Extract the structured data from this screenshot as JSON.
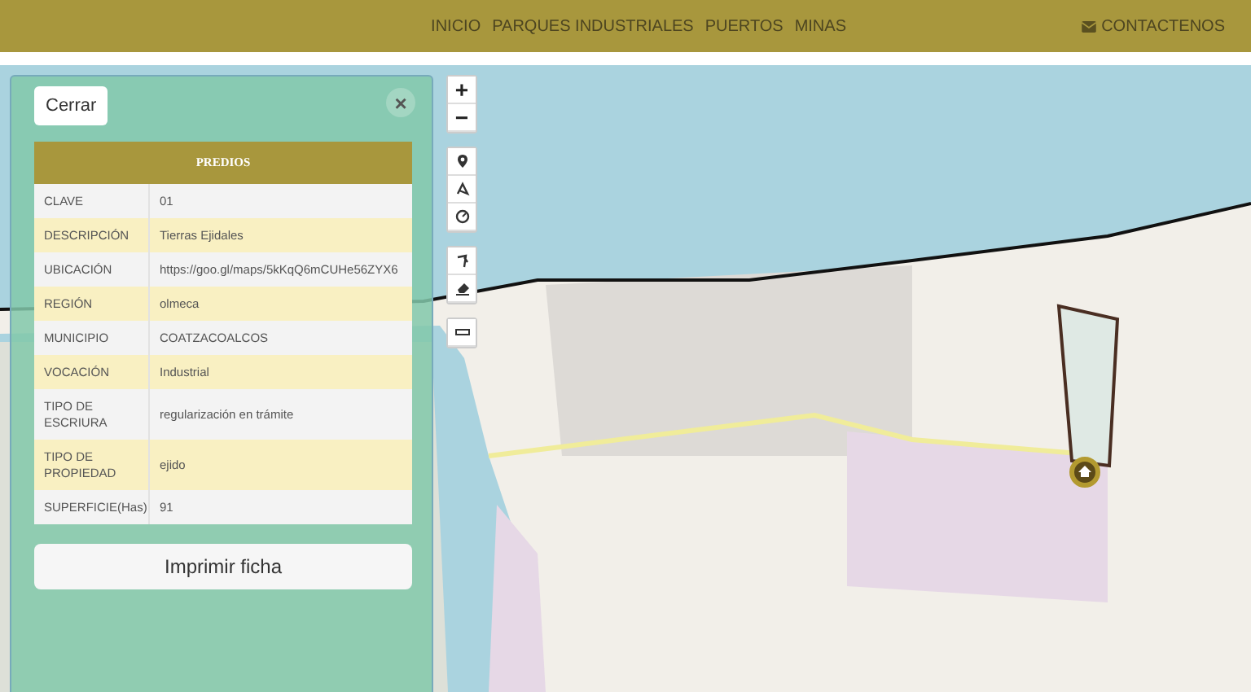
{
  "nav": {
    "items": [
      "INICIO",
      "PARQUES INDUSTRIALES",
      "PUERTOS",
      "MINAS"
    ],
    "contact": "CONTACTENOS"
  },
  "map_controls": {
    "zoom_in": "+",
    "zoom_out": "−"
  },
  "panel": {
    "close_button": "Cerrar",
    "close_icon": "×",
    "table": {
      "title": "PREDIOS",
      "rows": [
        {
          "label": "CLAVE",
          "value": "01"
        },
        {
          "label": "DESCRIPCIÓN",
          "value": "Tierras Ejidales"
        },
        {
          "label": "UBICACIÓN",
          "value": "https://goo.gl/maps/5kKqQ6mCUHe56ZYX6"
        },
        {
          "label": "REGIÓN",
          "value": "olmeca"
        },
        {
          "label": "MUNICIPIO",
          "value": "COATZACOALCOS"
        },
        {
          "label": "VOCACIÓN",
          "value": "Industrial"
        },
        {
          "label": "TIPO DE ESCRIURA",
          "value": "regularización en trámite"
        },
        {
          "label": "TIPO DE PROPIEDAD",
          "value": "ejido"
        },
        {
          "label": "SUPERFICIE(Has)",
          "value": "91"
        }
      ]
    },
    "print_button": "Imprimir ficha"
  }
}
